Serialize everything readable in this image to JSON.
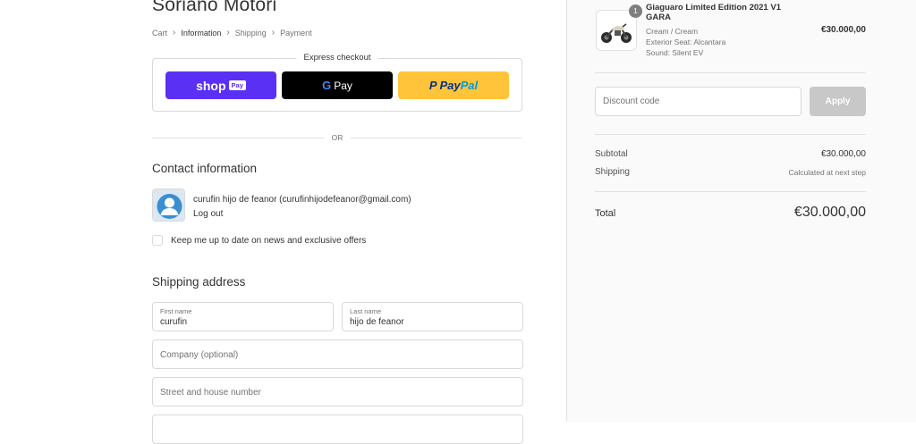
{
  "store": {
    "name": "Soriano Motori"
  },
  "breadcrumb": {
    "items": [
      {
        "label": "Cart"
      },
      {
        "label": "Information"
      },
      {
        "label": "Shipping"
      },
      {
        "label": "Payment"
      }
    ],
    "current": "Information"
  },
  "express": {
    "title": "Express checkout",
    "shop_pay": {
      "word": "shop",
      "badge": "Pay"
    },
    "gpay": {
      "g": "G",
      "word": "Pay"
    },
    "paypal": {
      "p": "P",
      "word1": "Pay",
      "word2": "Pal"
    }
  },
  "divider": {
    "or": "OR"
  },
  "contact": {
    "title": "Contact information",
    "email": "curufin hijo de feanor (curufinhijodefeanor@gmail.com)",
    "logout": "Log out",
    "newsletter": "Keep me up to date on news and exclusive offers"
  },
  "shipping": {
    "title": "Shipping address",
    "first_name": {
      "label": "First name",
      "value": "curufin"
    },
    "last_name": {
      "label": "Last name",
      "value": "hijo de feanor"
    },
    "company": {
      "placeholder": "Company (optional)"
    },
    "street": {
      "placeholder": "Street and house number"
    }
  },
  "order": {
    "quantity": "1",
    "product_name": "Giaguaro Limited Edition 2021 V1 GARA",
    "variants": [
      "Cream / Cream",
      "Exterior Seat: Alcantara",
      "Sound: Silent EV"
    ],
    "price": "€30.000,00"
  },
  "discount": {
    "placeholder": "Discount code",
    "apply": "Apply"
  },
  "summary": {
    "subtotal_label": "Subtotal",
    "subtotal_value": "€30.000,00",
    "shipping_label": "Shipping",
    "shipping_value": "Calculated at next step",
    "total_label": "Total",
    "total_value": "€30.000,00"
  },
  "colors": {
    "shop_pay": "#5a31f4",
    "gpay": "#000000",
    "paypal": "#ffc439",
    "apply_disabled": "#c8c8c8",
    "sidebar_bg": "#fafafa"
  }
}
